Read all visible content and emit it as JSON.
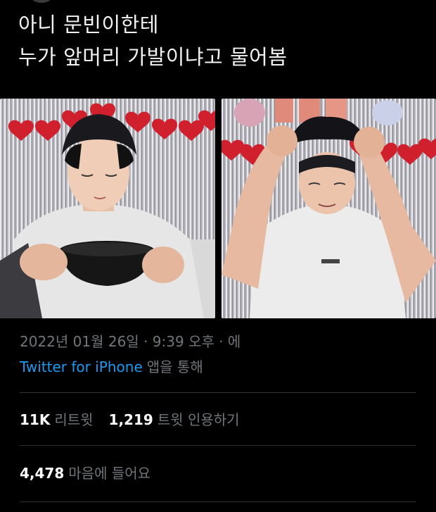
{
  "tweet": {
    "text_lines": [
      "아니 문빈이한테",
      "누가 앞머리 가발이냐고 물어봄"
    ]
  },
  "media": {
    "left_photo": "photo",
    "right_photo": "photo"
  },
  "meta": {
    "timestamp": "2022년 01월 26일 · 9:39 오후 · 에",
    "source_app": "Twitter for iPhone",
    "source_suffix": "앱을 통해"
  },
  "stats": {
    "retweets_count": "11K",
    "retweets_label": "리트윗",
    "quotes_count": "1,219",
    "quotes_label": "트윗 인용하기",
    "likes_count": "4,478",
    "likes_label": "마음에 들어요"
  },
  "colors": {
    "background": "#000000",
    "text": "#e7e9ea",
    "muted": "#71767b",
    "link": "#1d9bf0",
    "divider": "#2f3336"
  }
}
